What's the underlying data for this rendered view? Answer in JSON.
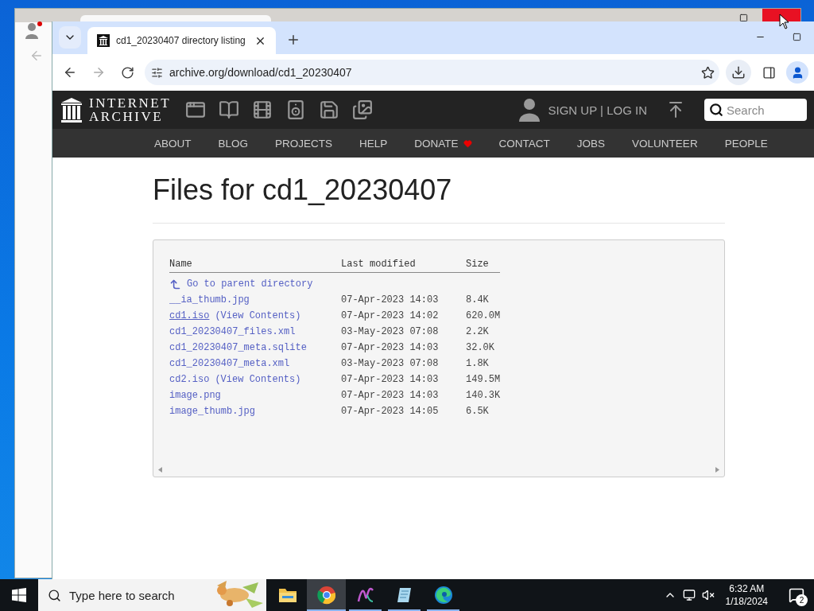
{
  "browser": {
    "tabs": [
      {
        "title": "cd1_20230407 directory listing",
        "selected": true
      }
    ],
    "url": "archive.org/download/cd1_20230407"
  },
  "site": {
    "logo_lines": [
      "INTERNET",
      "ARCHIVE"
    ],
    "auth": "SIGN UP | LOG IN",
    "search_placeholder": "Search",
    "nav": [
      {
        "label": "ABOUT",
        "heart": false
      },
      {
        "label": "BLOG",
        "heart": false
      },
      {
        "label": "PROJECTS",
        "heart": false
      },
      {
        "label": "HELP",
        "heart": false
      },
      {
        "label": "DONATE",
        "heart": true
      },
      {
        "label": "CONTACT",
        "heart": false
      },
      {
        "label": "JOBS",
        "heart": false
      },
      {
        "label": "VOLUNTEER",
        "heart": false
      },
      {
        "label": "PEOPLE",
        "heart": false
      }
    ]
  },
  "page": {
    "title": "Files for cd1_20230407",
    "columns": [
      "Name",
      "Last modified",
      "Size"
    ],
    "parent_link": "Go to parent directory",
    "rows": [
      {
        "name": "__ia_thumb.jpg",
        "modified": "07-Apr-2023 14:03",
        "size": "8.4K",
        "underlined": false
      },
      {
        "name": "cd1.iso",
        "extra": "(View Contents)",
        "modified": "07-Apr-2023 14:02",
        "size": "620.0M",
        "underlined": true
      },
      {
        "name": "cd1_20230407_files.xml",
        "modified": "03-May-2023 07:08",
        "size": "2.2K",
        "underlined": false
      },
      {
        "name": "cd1_20230407_meta.sqlite",
        "modified": "07-Apr-2023 14:03",
        "size": "32.0K",
        "underlined": false
      },
      {
        "name": "cd1_20230407_meta.xml",
        "modified": "03-May-2023 07:08",
        "size": "1.8K",
        "underlined": false
      },
      {
        "name": "cd2.iso",
        "extra": "(View Contents)",
        "modified": "07-Apr-2023 14:03",
        "size": "149.5M",
        "underlined": false
      },
      {
        "name": "image.png",
        "modified": "07-Apr-2023 14:03",
        "size": "140.3K",
        "underlined": false
      },
      {
        "name": "image_thumb.jpg",
        "modified": "07-Apr-2023 14:05",
        "size": "6.5K",
        "underlined": false
      }
    ]
  },
  "taskbar": {
    "search_placeholder": "Type here to search",
    "apps": [
      {
        "kind": "folder",
        "running": false,
        "selected": false
      },
      {
        "kind": "chrome",
        "running": true,
        "selected": true
      },
      {
        "kind": "scribble",
        "running": true,
        "selected": false
      },
      {
        "kind": "notepad",
        "running": true,
        "selected": false
      },
      {
        "kind": "edge",
        "running": true,
        "selected": false
      }
    ],
    "time": "6:32 AM",
    "date": "1/18/2024",
    "notifications": "2"
  }
}
